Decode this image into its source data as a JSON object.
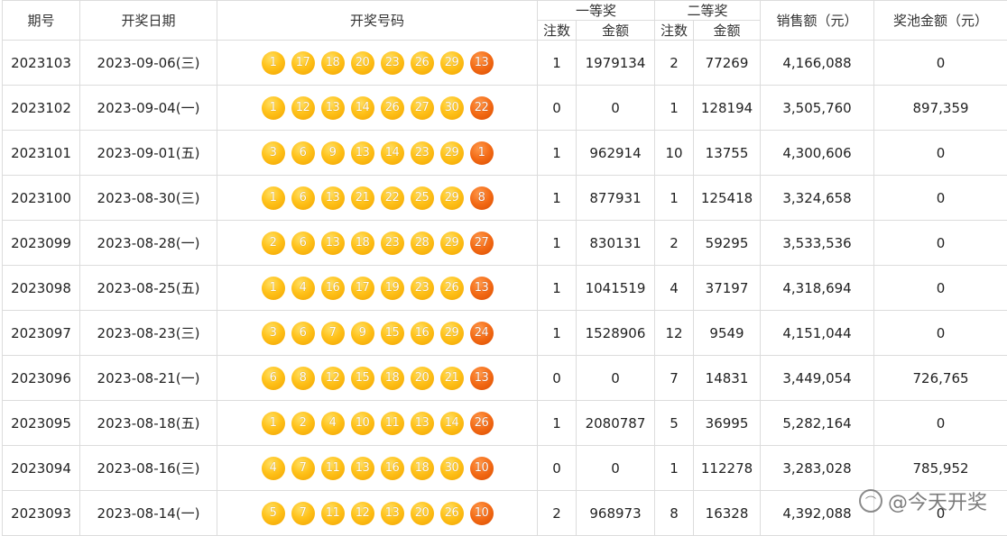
{
  "headers": {
    "period": "期号",
    "date": "开奖日期",
    "numbers": "开奖号码",
    "first_prize": "一等奖",
    "second_prize": "二等奖",
    "count": "注数",
    "amount": "金额",
    "sales": "销售额（元）",
    "pool": "奖池金额（元）"
  },
  "rows": [
    {
      "period": "2023103",
      "date": "2023-09-06(三)",
      "front": [
        "1",
        "17",
        "18",
        "20",
        "23",
        "26",
        "29"
      ],
      "back": "13",
      "first_count": "1",
      "first_amount": "1979134",
      "second_count": "2",
      "second_amount": "77269",
      "sales": "4,166,088",
      "pool": "0"
    },
    {
      "period": "2023102",
      "date": "2023-09-04(一)",
      "front": [
        "1",
        "12",
        "13",
        "14",
        "26",
        "27",
        "30"
      ],
      "back": "22",
      "first_count": "0",
      "first_amount": "0",
      "second_count": "1",
      "second_amount": "128194",
      "sales": "3,505,760",
      "pool": "897,359"
    },
    {
      "period": "2023101",
      "date": "2023-09-01(五)",
      "front": [
        "3",
        "6",
        "9",
        "13",
        "14",
        "23",
        "29"
      ],
      "back": "1",
      "first_count": "1",
      "first_amount": "962914",
      "second_count": "10",
      "second_amount": "13755",
      "sales": "4,300,606",
      "pool": "0"
    },
    {
      "period": "2023100",
      "date": "2023-08-30(三)",
      "front": [
        "1",
        "6",
        "13",
        "21",
        "22",
        "25",
        "29"
      ],
      "back": "8",
      "first_count": "1",
      "first_amount": "877931",
      "second_count": "1",
      "second_amount": "125418",
      "sales": "3,324,658",
      "pool": "0"
    },
    {
      "period": "2023099",
      "date": "2023-08-28(一)",
      "front": [
        "2",
        "6",
        "13",
        "18",
        "23",
        "28",
        "29"
      ],
      "back": "27",
      "first_count": "1",
      "first_amount": "830131",
      "second_count": "2",
      "second_amount": "59295",
      "sales": "3,533,536",
      "pool": "0"
    },
    {
      "period": "2023098",
      "date": "2023-08-25(五)",
      "front": [
        "1",
        "4",
        "16",
        "17",
        "19",
        "23",
        "26"
      ],
      "back": "13",
      "first_count": "1",
      "first_amount": "1041519",
      "second_count": "4",
      "second_amount": "37197",
      "sales": "4,318,694",
      "pool": "0"
    },
    {
      "period": "2023097",
      "date": "2023-08-23(三)",
      "front": [
        "3",
        "6",
        "7",
        "9",
        "15",
        "16",
        "29"
      ],
      "back": "24",
      "first_count": "1",
      "first_amount": "1528906",
      "second_count": "12",
      "second_amount": "9549",
      "sales": "4,151,044",
      "pool": "0"
    },
    {
      "period": "2023096",
      "date": "2023-08-21(一)",
      "front": [
        "6",
        "8",
        "12",
        "15",
        "18",
        "20",
        "21"
      ],
      "back": "13",
      "first_count": "0",
      "first_amount": "0",
      "second_count": "7",
      "second_amount": "14831",
      "sales": "3,449,054",
      "pool": "726,765"
    },
    {
      "period": "2023095",
      "date": "2023-08-18(五)",
      "front": [
        "1",
        "2",
        "4",
        "10",
        "11",
        "13",
        "14"
      ],
      "back": "26",
      "first_count": "1",
      "first_amount": "2080787",
      "second_count": "5",
      "second_amount": "36995",
      "sales": "5,282,164",
      "pool": "0"
    },
    {
      "period": "2023094",
      "date": "2023-08-16(三)",
      "front": [
        "4",
        "7",
        "11",
        "13",
        "16",
        "18",
        "30"
      ],
      "back": "10",
      "first_count": "0",
      "first_amount": "0",
      "second_count": "1",
      "second_amount": "112278",
      "sales": "3,283,028",
      "pool": "785,952"
    },
    {
      "period": "2023093",
      "date": "2023-08-14(一)",
      "front": [
        "5",
        "7",
        "11",
        "12",
        "13",
        "20",
        "26"
      ],
      "back": "10",
      "first_count": "2",
      "first_amount": "968973",
      "second_count": "8",
      "second_amount": "16328",
      "sales": "4,392,088",
      "pool": "0"
    }
  ],
  "watermark": "@今天开奖",
  "watermark_icon": "chat-bubble-icon"
}
